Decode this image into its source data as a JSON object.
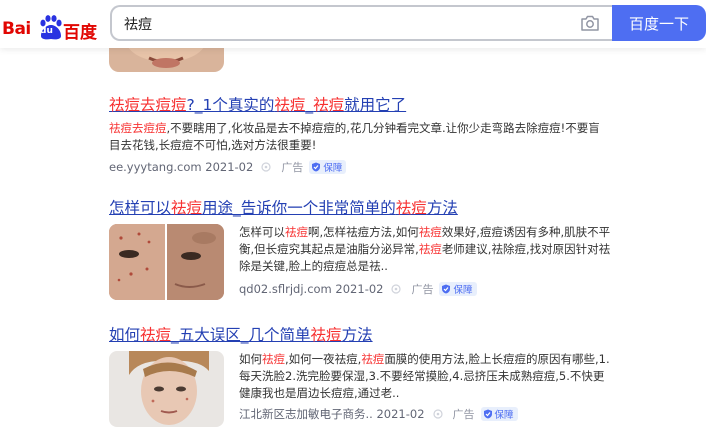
{
  "header": {
    "logo_bai": "Bai",
    "logo_du": "du",
    "logo_cn": "百度",
    "query": "祛痘",
    "search_button": "百度一下"
  },
  "results": [
    {
      "title_parts": [
        "祛痘去痘痘",
        "?_1个真实的",
        "祛痘",
        "_",
        "祛痘",
        "就用它了"
      ],
      "desc_parts": [
        "祛痘去痘痘",
        ",不要瞎用了,化妆品是去不掉痘痘的,花几分钟看完文章.让你少走弯路去除痘痘!不要盲目去花钱,长痘痘不可怕,选对方法很重要!"
      ],
      "source": "ee.yyytang.com",
      "date": "2021-02",
      "ad_label": "广告",
      "guard_label": "保障"
    },
    {
      "title_parts": [
        "怎样可以",
        "祛痘",
        "用途_告诉你一个非常简单的",
        "祛痘",
        "方法"
      ],
      "desc_parts": [
        "怎样可以",
        "祛痘",
        "啊,怎样祛痘方法,如何",
        "祛痘",
        "效果好,痘痘诱因有多种,肌肤不平衡,但长痘究其起点是油脂分泌异常,",
        "祛痘",
        "老师建议,祛除痘,找对原因针对祛除是关键,脸上的痘痘总是祛.."
      ],
      "source": "qd02.sflrjdj.com",
      "date": "2021-02",
      "ad_label": "广告",
      "guard_label": "保障"
    },
    {
      "title_parts": [
        "如何",
        "祛痘",
        "_五大误区_几个简单",
        "祛痘",
        "方法"
      ],
      "desc_parts": [
        "如何",
        "祛痘",
        ",如何一夜祛痘,",
        "祛痘",
        "面膜的使用方法,脸上长痘痘的原因有哪些,1.每天洗脸2.洗完脸要保湿,3.不要经常摸脸,4.忌挤压未成熟痘痘,5.不快更健康我也是眉边长痘痘,通过老.."
      ],
      "source": "江北新区志加敏电子商务..",
      "date": "2021-02",
      "ad_label": "广告",
      "guard_label": "保障"
    }
  ],
  "colors": {
    "link": "#2440b3",
    "highlight": "#f73131",
    "button": "#4e6ef2",
    "logo_red": "#e10602",
    "logo_blue": "#2932e1"
  }
}
